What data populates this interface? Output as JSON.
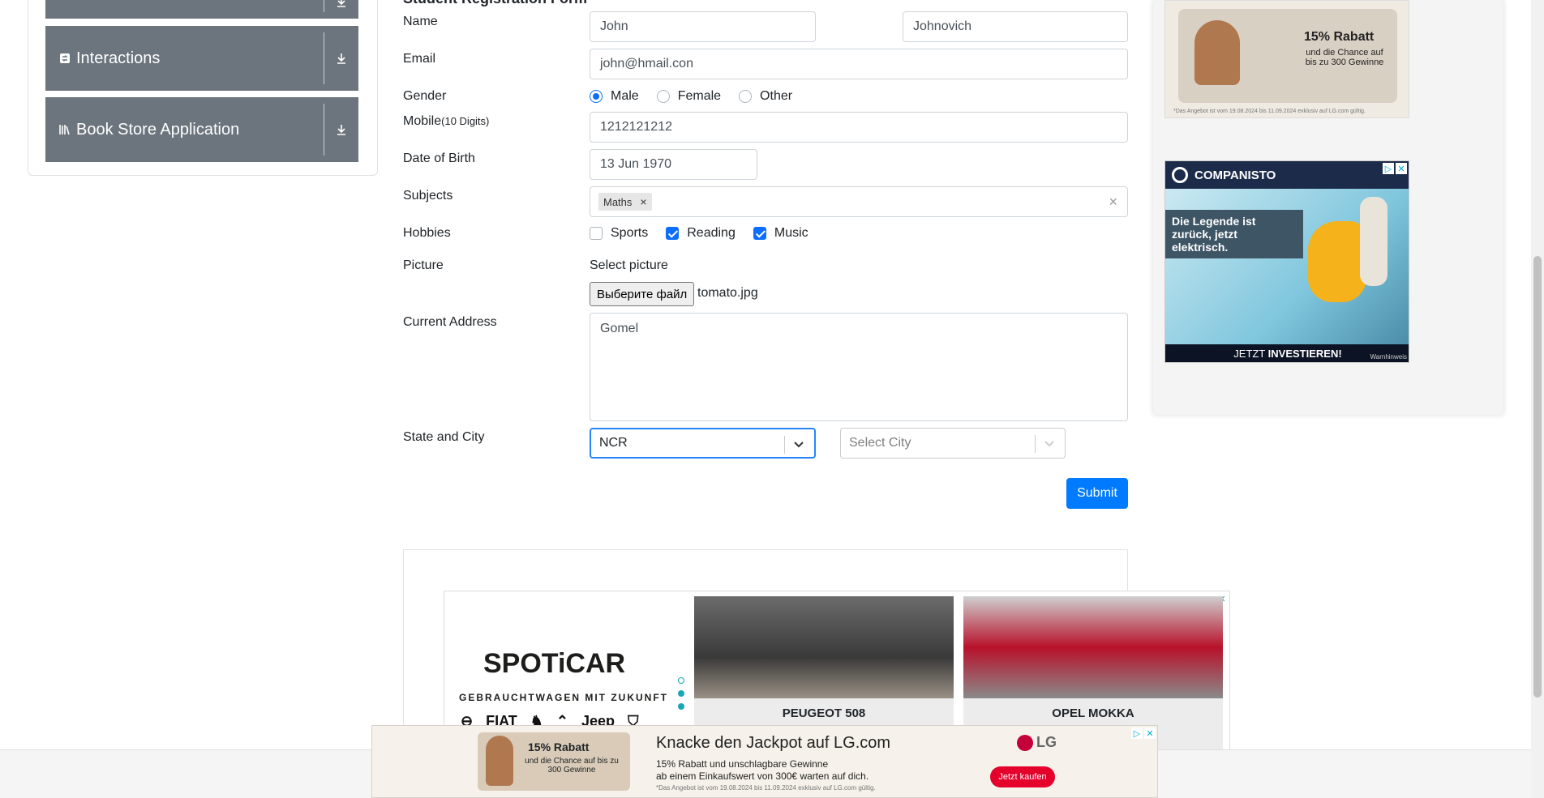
{
  "sidebar": {
    "groups": [
      {
        "label": "Interactions",
        "icon": "interactions-icon"
      },
      {
        "label": "Book Store Application",
        "icon": "book-icon"
      }
    ]
  },
  "form": {
    "heading": "Student Registration Form",
    "name_label": "Name",
    "first_name": "John",
    "last_name": "Johnovich",
    "email_label": "Email",
    "email": "john@hmail.con",
    "gender_label": "Gender",
    "gender_options": [
      "Male",
      "Female",
      "Other"
    ],
    "gender_selected": "Male",
    "mobile_label": "Mobile",
    "mobile_hint": "(10 Digits)",
    "mobile": "1212121212",
    "dob_label": "Date of Birth",
    "dob": "13 Jun 1970",
    "subjects_label": "Subjects",
    "subjects": [
      "Maths"
    ],
    "hobbies_label": "Hobbies",
    "hobbies": [
      {
        "label": "Sports",
        "checked": false
      },
      {
        "label": "Reading",
        "checked": true
      },
      {
        "label": "Music",
        "checked": true
      }
    ],
    "picture_label": "Picture",
    "picture_caption": "Select picture",
    "file_button": "Выберите файл",
    "file_name": "tomato.jpg",
    "address_label": "Current Address",
    "address": "Gomel",
    "state_city_label": "State and City",
    "state": "NCR",
    "city_placeholder": "Select City",
    "submit": "Submit"
  },
  "ads": {
    "lg_top": {
      "headline": "15% Rabatt",
      "text": "und die Chance auf bis zu 300 Gewinne",
      "fine": "*Das Angebot ist vom 19.08.2024 bis 11.09.2024 exklusiv auf LG.com gültig."
    },
    "companisto": {
      "brand": "COMPANISTO",
      "text": "Die Legende ist zurück, jetzt elektrisch.",
      "cta_prefix": "JETZT ",
      "cta_bold": "INVESTIEREN!",
      "note": "Warnhinweis"
    },
    "spoticar": {
      "brand": "SPOTiCAR",
      "tagline": "GEBRAUCHTWAGEN MIT ZUKUNFT",
      "logos": [
        "FIAT",
        "Jeep"
      ],
      "car1": "PEUGEOT 508",
      "car2": "OPEL MOKKA"
    },
    "lg_bottom": {
      "headline": "Knacke den Jackpot auf LG.com",
      "line1": "15% Rabatt und unschlagbare Gewinne",
      "line2": "ab einem Einkaufswert von 300€ warten auf dich.",
      "fine": "*Das Angebot ist vom 19.08.2024 bis 11.09.2024 exklusiv auf LG.com gültig.",
      "badge_title": "15% Rabatt",
      "badge_text": "und die Chance auf bis zu 300 Gewinne",
      "brand": "LG",
      "cta": "Jetzt kaufen"
    }
  },
  "colors": {
    "primary": "#007bff",
    "sidebar_group": "#6c757d",
    "lg_red": "#e4002b"
  }
}
